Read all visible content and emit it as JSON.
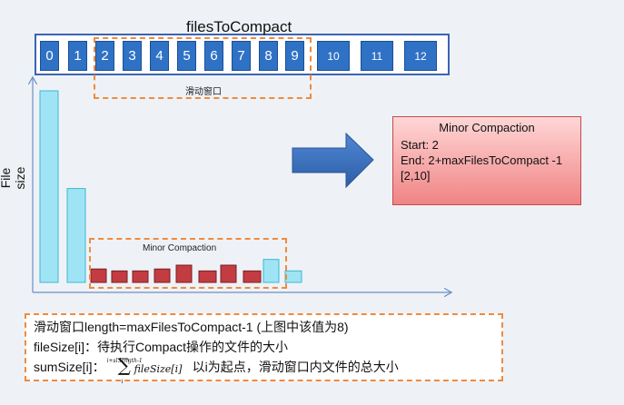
{
  "title": "filesToCompact",
  "file_indices": [
    "0",
    "1",
    "2",
    "3",
    "4",
    "5",
    "6",
    "7",
    "8",
    "9",
    "10",
    "11",
    "12"
  ],
  "sliding_window_label": "滑动窗口",
  "y_axis_label": "File size",
  "minor_compaction_label": "Minor Compaction",
  "colors": {
    "file_cell": "#2f72c5",
    "dashed_border": "#f08a3e",
    "arrow": "#3b74c4",
    "selected_bar": "#c23c42",
    "other_bar": "#9fe4f4",
    "info_box": "#f39a9a"
  },
  "bars": [
    {
      "value": 100,
      "selected": false
    },
    {
      "value": 49,
      "selected": false
    },
    {
      "value": 7,
      "selected": true
    },
    {
      "value": 6,
      "selected": true
    },
    {
      "value": 6,
      "selected": true
    },
    {
      "value": 7,
      "selected": true
    },
    {
      "value": 9,
      "selected": true
    },
    {
      "value": 6,
      "selected": true
    },
    {
      "value": 9,
      "selected": true
    },
    {
      "value": 6,
      "selected": true
    },
    {
      "value": 12,
      "selected": false
    },
    {
      "value": 6,
      "selected": false
    }
  ],
  "info_box": {
    "title": "Minor Compaction",
    "start": "Start: 2",
    "end": "End: 2+maxFilesToCompact -1",
    "range": "[2,10]"
  },
  "notes": {
    "line1": "滑动窗口length=maxFilesToCompact-1 (上图中该值为8)",
    "line2": "fileSize[i]：待执行Compact操作的文件的大小",
    "line3_prefix": "sumSize[i]：",
    "line3_sum_upper": "i+sl.length-1",
    "line3_sum_lower": "i",
    "line3_sum_body": "fileSize[i]",
    "line3_suffix": "以i为起点，滑动窗口内文件的总大小"
  }
}
